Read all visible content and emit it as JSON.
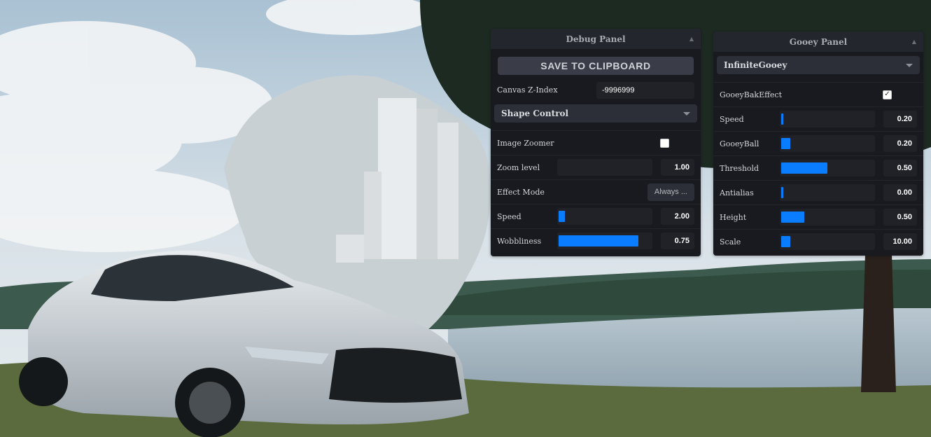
{
  "colors": {
    "panel_bg": "#181a1f",
    "panel_header": "#24262d",
    "accent": "#0a7dff"
  },
  "scene": {
    "description_icon": "car-photo-background"
  },
  "debug_panel": {
    "title": "Debug Panel",
    "save_button": "SAVE TO CLIPBOARD",
    "canvas_z_index": {
      "label": "Canvas Z-Index",
      "value": "-9996999"
    },
    "shape_control": {
      "label": "Shape Control"
    },
    "image_zoomer": {
      "label": "Image Zoomer",
      "checked": false
    },
    "zoom_level": {
      "label": "Zoom level",
      "value": "1.00",
      "fraction": 0.0
    },
    "effect_mode": {
      "label": "Effect Mode",
      "value": "Always ..."
    },
    "speed": {
      "label": "Speed",
      "value": "2.00",
      "fraction": 0.07
    },
    "wobbliness": {
      "label": "Wobbliness",
      "value": "0.75",
      "fraction": 0.86
    }
  },
  "gooey_panel": {
    "title": "Gooey Panel",
    "preset": {
      "label": "InfiniteGooey"
    },
    "bak_effect": {
      "label": "GooeyBakEffect",
      "checked": true
    },
    "speed": {
      "label": "Speed",
      "value": "0.20",
      "fraction": 0.02
    },
    "gooey_ball": {
      "label": "GooeyBall",
      "value": "0.20",
      "fraction": 0.1
    },
    "threshold": {
      "label": "Threshold",
      "value": "0.50",
      "fraction": 0.5
    },
    "antialias": {
      "label": "Antialias",
      "value": "0.00",
      "fraction": 0.0
    },
    "height": {
      "label": "Height",
      "value": "0.50",
      "fraction": 0.25
    },
    "scale": {
      "label": "Scale",
      "value": "10.00",
      "fraction": 0.1
    }
  }
}
